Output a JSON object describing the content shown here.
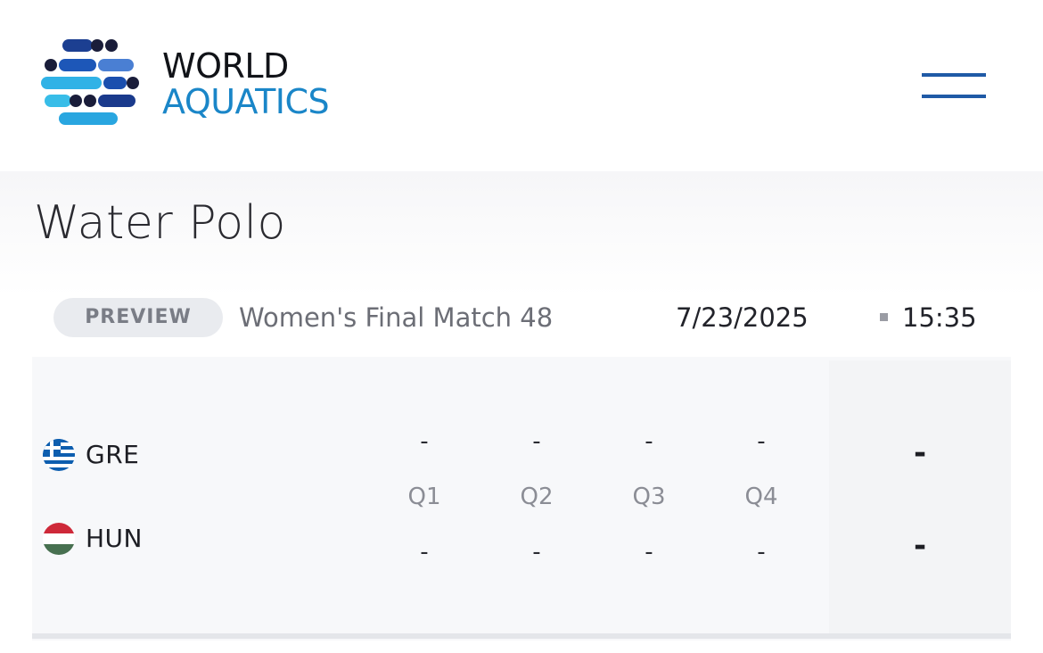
{
  "brand": {
    "line1": "WORLD",
    "line2": "AQUATICS",
    "colors": {
      "dark": "#111318",
      "blue": "#1a86c8",
      "navy": "#1f5aa6"
    }
  },
  "header": {
    "menu_icon": "hamburger-menu-icon"
  },
  "page": {
    "title": "Water Polo"
  },
  "match": {
    "status": "PREVIEW",
    "name": "Women's Final Match 48",
    "date": "7/23/2025",
    "time": "15:35"
  },
  "scoreboard": {
    "periods": [
      "Q1",
      "Q2",
      "Q3",
      "Q4"
    ],
    "teams": [
      {
        "code": "GRE",
        "flag": "greece-flag-icon",
        "periods": [
          "-",
          "-",
          "-",
          "-"
        ],
        "total": "-"
      },
      {
        "code": "HUN",
        "flag": "hungary-flag-icon",
        "periods": [
          "-",
          "-",
          "-",
          "-"
        ],
        "total": "-"
      }
    ]
  }
}
